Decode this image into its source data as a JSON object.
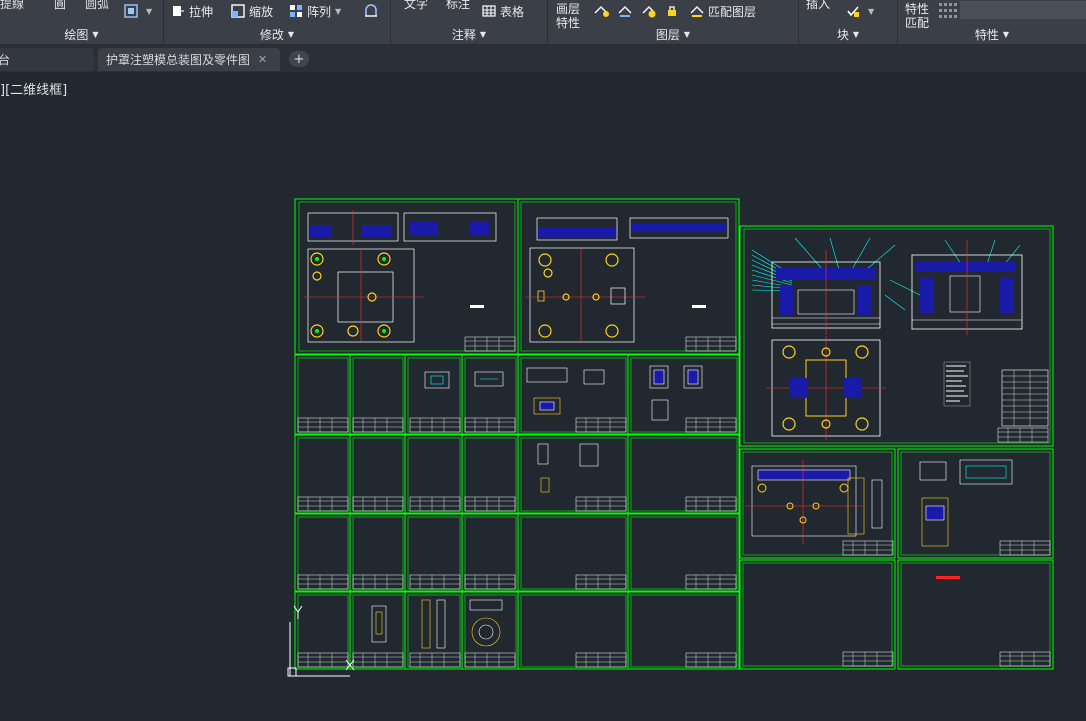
{
  "ribbon": {
    "buttons": {
      "stretch": "拉伸",
      "scale": "缩放",
      "array": "阵列",
      "table": "表格",
      "match_layer": "匹配图层",
      "layer_properties_line1": "画层",
      "layer_properties_line2": "特性",
      "match_props_line1": "特性",
      "match_props_line2": "匹配"
    },
    "panels": {
      "draw": "绘图",
      "modify": "修改",
      "annotate": "注释",
      "layers": "图层",
      "block": "块",
      "properties": "特性"
    }
  },
  "tabs": [
    {
      "label": "台"
    },
    {
      "label": "护罩注塑模总装图及零件图"
    }
  ],
  "viewport": {
    "label": "][二维线框]"
  },
  "colors": {
    "background": "#212830",
    "frame": "#00ff00",
    "ucs": "#ffffff"
  }
}
